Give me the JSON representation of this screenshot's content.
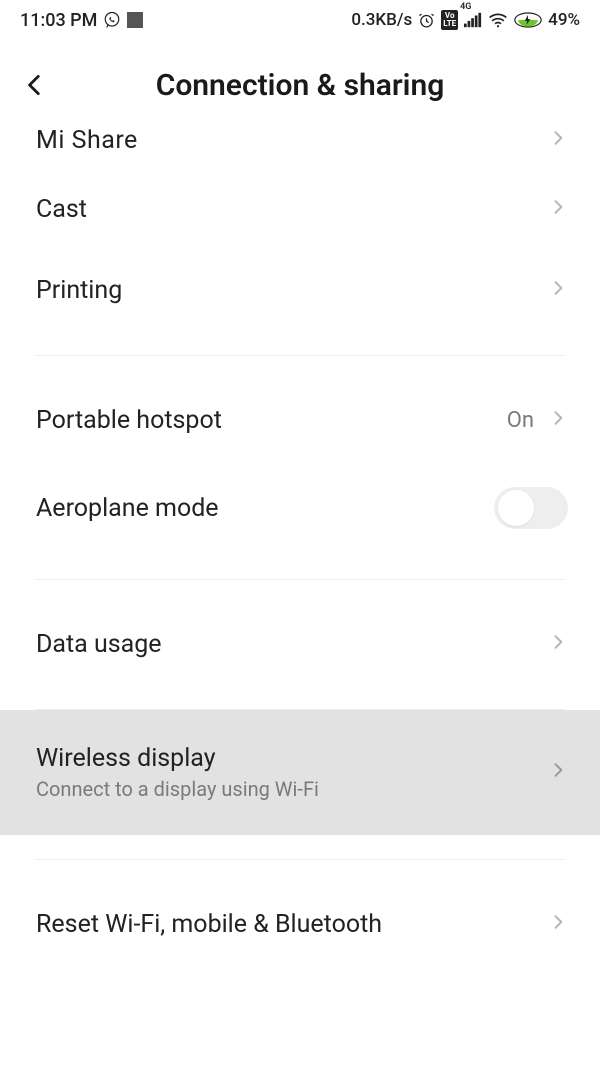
{
  "status": {
    "time": "11:03 PM",
    "data_rate": "0.3KB/s",
    "battery_pct": "49%",
    "network_badge": "4G",
    "volte_badge": "Vo LTE"
  },
  "header": {
    "title": "Connection & sharing"
  },
  "rows": {
    "mi_share": "Mi Share",
    "cast": "Cast",
    "printing": "Printing",
    "portable_hotspot": "Portable hotspot",
    "portable_hotspot_value": "On",
    "aeroplane_mode": "Aeroplane mode",
    "data_usage": "Data usage",
    "wireless_display": "Wireless display",
    "wireless_display_sub": "Connect to a display using Wi-Fi",
    "reset": "Reset Wi-Fi, mobile & Bluetooth"
  }
}
